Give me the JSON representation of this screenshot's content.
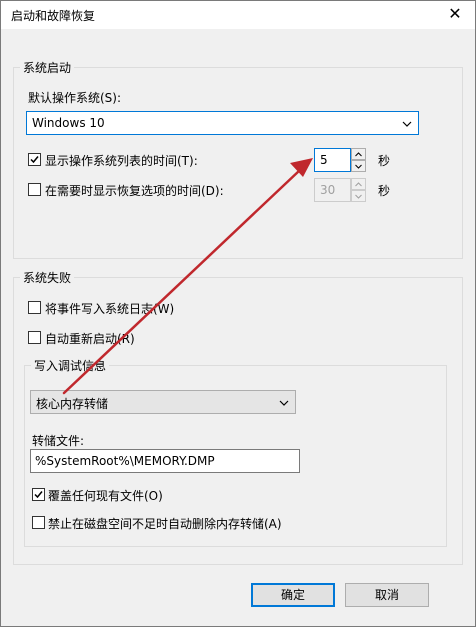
{
  "window": {
    "title": "启动和故障恢复",
    "close_label": "✕"
  },
  "system_startup": {
    "group_title": "系统启动",
    "default_os_label": "默认操作系统(S):",
    "default_os_value": "Windows 10",
    "show_os_list": {
      "checked": true,
      "label": "显示操作系统列表的时间(T):",
      "value": "5",
      "unit": "秒"
    },
    "show_recovery": {
      "checked": false,
      "label": "在需要时显示恢复选项的时间(D):",
      "value": "30",
      "unit": "秒"
    }
  },
  "system_failure": {
    "group_title": "系统失败",
    "write_event": {
      "checked": false,
      "label": "将事件写入系统日志(W)"
    },
    "auto_restart": {
      "checked": false,
      "label": "自动重新启动(R)"
    },
    "debug": {
      "group_title": "写入调试信息",
      "type_value": "核心内存转储",
      "dump_file_label": "转储文件:",
      "dump_file_value": "%SystemRoot%\\MEMORY.DMP",
      "overwrite": {
        "checked": true,
        "label": "覆盖任何现有文件(O)"
      },
      "disable_auto_delete": {
        "checked": false,
        "label": "禁止在磁盘空间不足时自动删除内存转储(A)"
      }
    }
  },
  "buttons": {
    "ok": "确定",
    "cancel": "取消"
  },
  "colors": {
    "annotation_arrow": "#c0282d",
    "focus_blue": "#0078d7"
  }
}
